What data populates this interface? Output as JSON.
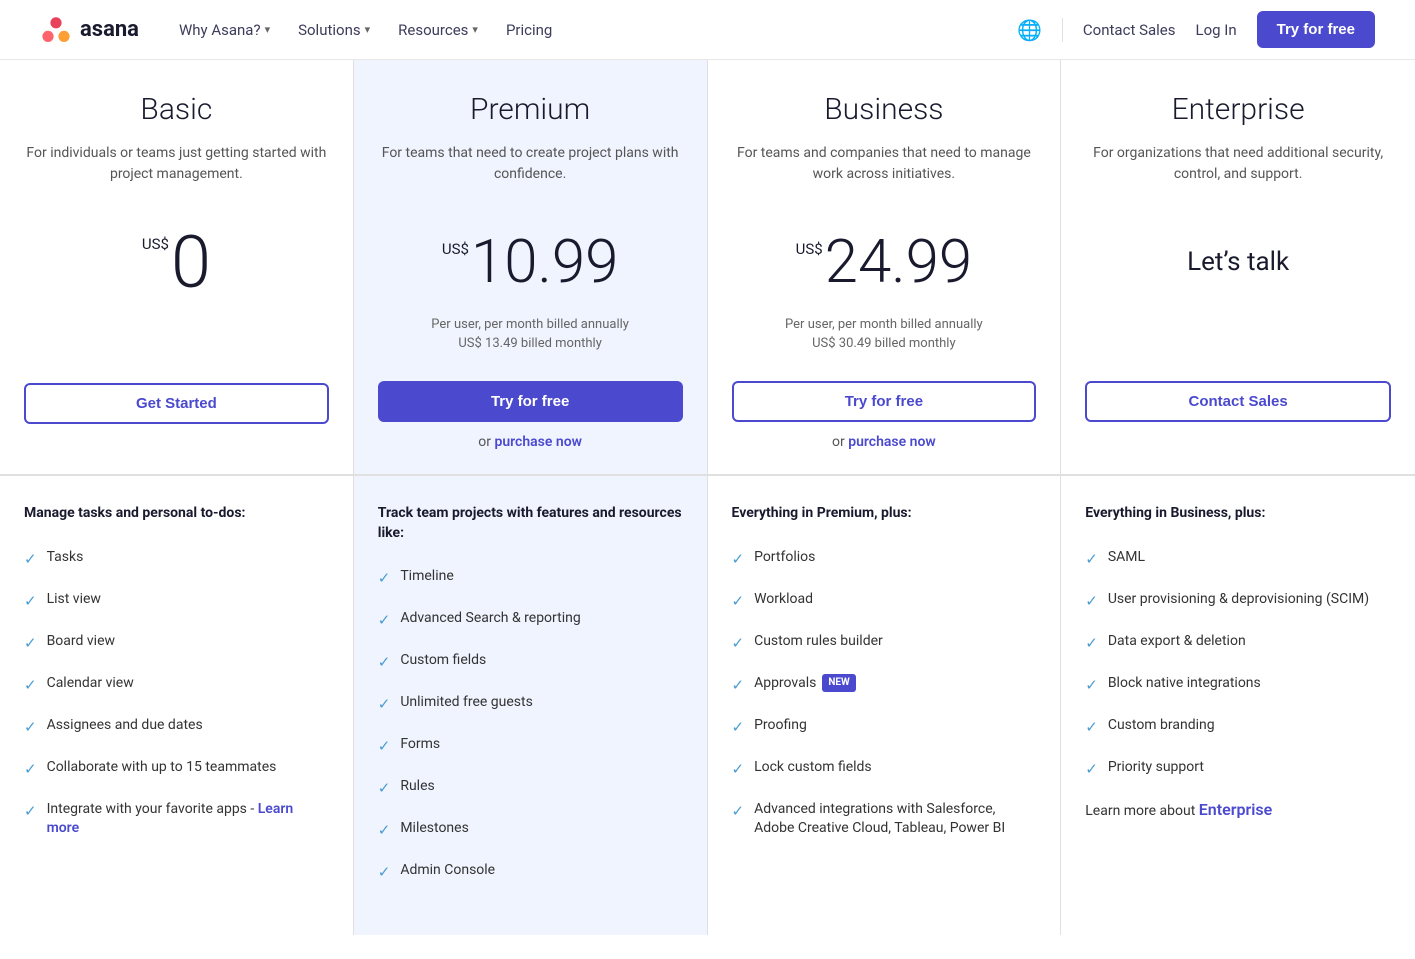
{
  "nav": {
    "logo_text": "asana",
    "links": [
      {
        "label": "Why Asana?",
        "has_chevron": true
      },
      {
        "label": "Solutions",
        "has_chevron": true
      },
      {
        "label": "Resources",
        "has_chevron": true
      },
      {
        "label": "Pricing",
        "has_chevron": false
      }
    ],
    "contact_sales": "Contact Sales",
    "log_in": "Log In",
    "try_free": "Try for free"
  },
  "plans": [
    {
      "id": "basic",
      "name": "Basic",
      "desc": "For individuals or teams just getting started with project management.",
      "currency": "US$",
      "price": "0",
      "price_type": "zero",
      "billed_line1": "",
      "billed_line2": "",
      "cta_label": "Get Started",
      "cta_type": "outline",
      "purchase_text": "",
      "purchase_link": "",
      "featured": false
    },
    {
      "id": "premium",
      "name": "Premium",
      "desc": "For teams that need to create project plans with confidence.",
      "currency": "US$",
      "price": "10.99",
      "price_type": "big",
      "billed_line1": "Per user, per month billed annually",
      "billed_line2": "US$ 13.49 billed monthly",
      "cta_label": "Try for free",
      "cta_type": "solid",
      "purchase_text": "or",
      "purchase_link": "purchase now",
      "featured": true
    },
    {
      "id": "business",
      "name": "Business",
      "desc": "For teams and companies that need to manage work across initiatives.",
      "currency": "US$",
      "price": "24.99",
      "price_type": "big",
      "billed_line1": "Per user, per month billed annually",
      "billed_line2": "US$ 30.49 billed monthly",
      "cta_label": "Try for free",
      "cta_type": "outline",
      "purchase_text": "or",
      "purchase_link": "purchase now",
      "featured": false
    },
    {
      "id": "enterprise",
      "name": "Enterprise",
      "desc": "For organizations that need additional security, control, and support.",
      "currency": "",
      "price": "Let’s talk",
      "price_type": "lets-talk",
      "billed_line1": "",
      "billed_line2": "",
      "cta_label": "Contact Sales",
      "cta_type": "outline",
      "purchase_text": "",
      "purchase_link": "",
      "featured": false
    }
  ],
  "features": [
    {
      "heading": "Manage tasks and personal to-dos:",
      "items": [
        {
          "text": "Tasks",
          "badge": null
        },
        {
          "text": "List view",
          "badge": null
        },
        {
          "text": "Board view",
          "badge": null
        },
        {
          "text": "Calendar view",
          "badge": null
        },
        {
          "text": "Assignees and due dates",
          "badge": null
        },
        {
          "text": "Collaborate with up to 15 teammates",
          "badge": null
        },
        {
          "text": "Integrate with your favorite apps - ",
          "badge": null,
          "link": "Learn more",
          "is_learn": true
        }
      ]
    },
    {
      "heading": "Track team projects with features and resources like:",
      "items": [
        {
          "text": "Timeline",
          "badge": null
        },
        {
          "text": "Advanced Search & reporting",
          "badge": null
        },
        {
          "text": "Custom fields",
          "badge": null
        },
        {
          "text": "Unlimited free guests",
          "badge": null
        },
        {
          "text": "Forms",
          "badge": null
        },
        {
          "text": "Rules",
          "badge": null
        },
        {
          "text": "Milestones",
          "badge": null
        },
        {
          "text": "Admin Console",
          "badge": null
        }
      ]
    },
    {
      "heading": "Everything in Premium, plus:",
      "items": [
        {
          "text": "Portfolios",
          "badge": null
        },
        {
          "text": "Workload",
          "badge": null
        },
        {
          "text": "Custom rules builder",
          "badge": null
        },
        {
          "text": "Approvals",
          "badge": "NEW"
        },
        {
          "text": "Proofing",
          "badge": null
        },
        {
          "text": "Lock custom fields",
          "badge": null
        },
        {
          "text": "Advanced integrations with Salesforce, Adobe Creative Cloud, Tableau, Power BI",
          "badge": null
        }
      ]
    },
    {
      "heading": "Everything in Business, plus:",
      "items": [
        {
          "text": "SAML",
          "badge": null
        },
        {
          "text": "User provisioning & deprovisioning (SCIM)",
          "badge": null
        },
        {
          "text": "Data export & deletion",
          "badge": null
        },
        {
          "text": "Block native integrations",
          "badge": null
        },
        {
          "text": "Custom branding",
          "badge": null
        },
        {
          "text": "Priority support",
          "badge": null
        }
      ],
      "learn_more_text": "Learn more about",
      "learn_more_link": "Enterprise"
    }
  ]
}
